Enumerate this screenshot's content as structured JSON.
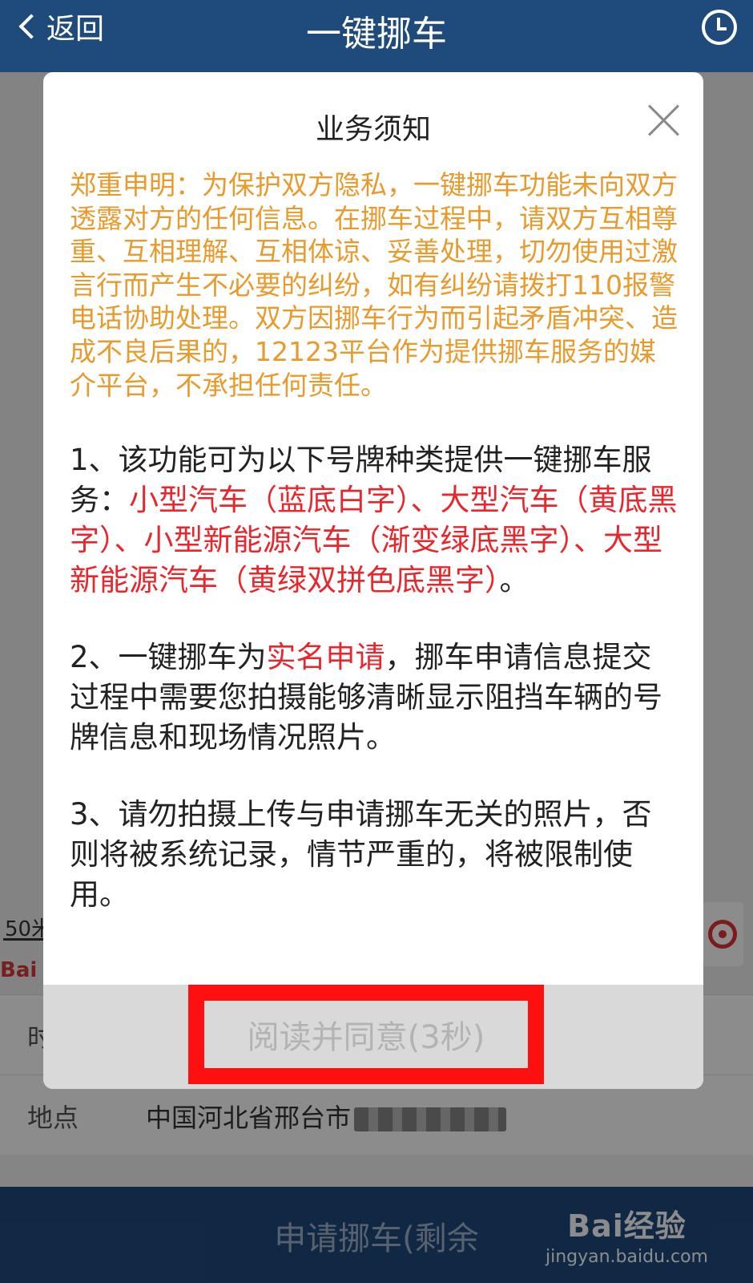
{
  "nav": {
    "back_label": "返回",
    "title": "一键挪车"
  },
  "map": {
    "scale_label": "50米",
    "logo_text": "Bai"
  },
  "form": {
    "time_label": "时",
    "place_label": "地点",
    "place_value": "中国河北省邢台市"
  },
  "footer": {
    "apply_label": "申请挪车(剩余",
    "watermark_brand": "Bai经验",
    "watermark_url": "jingyan.baidu.com"
  },
  "modal": {
    "title": "业务须知",
    "notice": "郑重申明：为保护双方隐私，一键挪车功能未向双方透露对方的任何信息。在挪车过程中，请双方互相尊重、互相理解、互相体谅、妥善处理，切勿使用过激言行而产生不必要的纠纷，如有纠纷请拨打110报警电话协助处理。双方因挪车行为而引起矛盾冲突、造成不良后果的，12123平台作为提供挪车服务的媒介平台，不承担任何责任。",
    "clause1_prefix": "1、该功能可为以下号牌种类提供一键挪车服务：",
    "clause1_highlight": "小型汽车（蓝底白字）、大型汽车（黄底黑字）、小型新能源汽车（渐变绿底黑字）、大型新能源汽车（黄绿双拼色底黑字）",
    "clause1_suffix": "。",
    "clause2_prefix": "2、一键挪车为",
    "clause2_highlight": "实名申请",
    "clause2_suffix": "，挪车申请信息提交过程中需要您拍摄能够清晰显示阻挡车辆的号牌信息和现场情况照片。",
    "clause3": "3、请勿拍摄上传与申请挪车无关的照片，否则将被系统记录，情节严重的，将被限制使用。",
    "agree_label": "阅读并同意(3秒)"
  },
  "colors": {
    "nav_bg": "#1f4a7c",
    "notice_orange": "#e89a2c",
    "highlight_red": "#e8262b",
    "annotation_box": "#ff1010"
  }
}
